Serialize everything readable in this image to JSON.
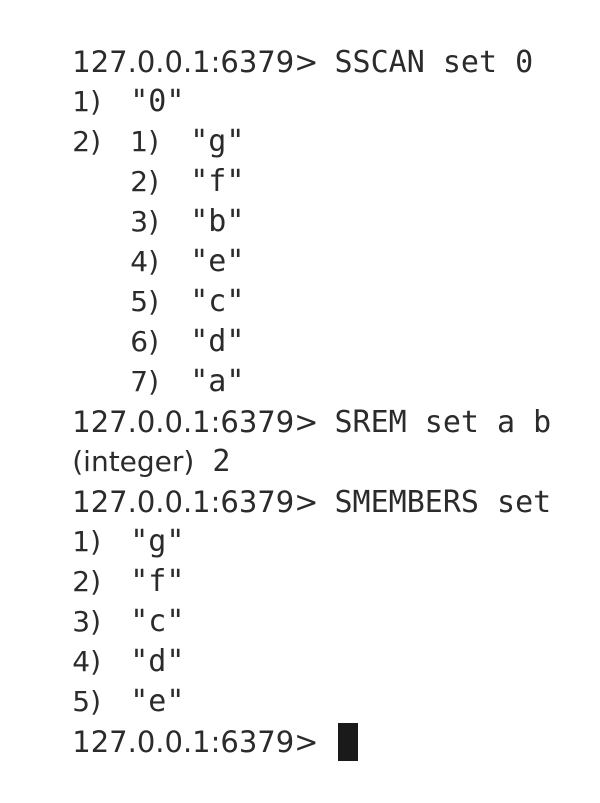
{
  "terminal": {
    "prompt": "127.0.0.1:6379>",
    "sscan": {
      "command": "SSCAN set 0",
      "outer": [
        {
          "index": "1)",
          "value": "\"0\""
        },
        {
          "index": "2)"
        }
      ],
      "nested": [
        {
          "index": "1)",
          "value": "\"g\""
        },
        {
          "index": "2)",
          "value": "\"f\""
        },
        {
          "index": "3)",
          "value": "\"b\""
        },
        {
          "index": "4)",
          "value": "\"e\""
        },
        {
          "index": "5)",
          "value": "\"c\""
        },
        {
          "index": "6)",
          "value": "\"d\""
        },
        {
          "index": "7)",
          "value": "\"a\""
        }
      ]
    },
    "srem": {
      "command": "SREM set a b",
      "result_type": "(integer)",
      "result_value": "2"
    },
    "smembers": {
      "command": "SMEMBERS set",
      "items": [
        {
          "index": "1)",
          "value": "\"g\""
        },
        {
          "index": "2)",
          "value": "\"f\""
        },
        {
          "index": "3)",
          "value": "\"c\""
        },
        {
          "index": "4)",
          "value": "\"d\""
        },
        {
          "index": "5)",
          "value": "\"e\""
        }
      ]
    }
  }
}
